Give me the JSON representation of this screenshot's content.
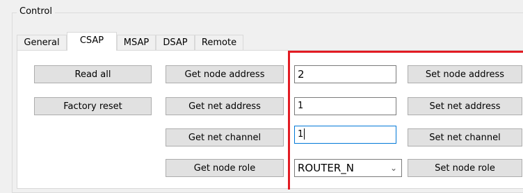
{
  "group": {
    "title": "Control"
  },
  "tabs": [
    {
      "label": "General",
      "active": false
    },
    {
      "label": "CSAP",
      "active": true
    },
    {
      "label": "MSAP",
      "active": false
    },
    {
      "label": "DSAP",
      "active": false
    },
    {
      "label": "Remote",
      "active": false
    }
  ],
  "buttons": {
    "read_all": "Read all",
    "factory_reset": "Factory reset",
    "get_node_address": "Get node address",
    "get_net_address": "Get net address",
    "get_net_channel": "Get net channel",
    "get_node_role": "Get node role",
    "set_node_address": "Set node address",
    "set_net_address": "Set net address",
    "set_net_channel": "Set net channel",
    "set_node_role": "Set node role"
  },
  "fields": {
    "node_address": "2",
    "net_address": "1",
    "net_channel": "1"
  },
  "node_role": {
    "selected": "ROUTER_N",
    "arrow_icon": "chevron-down-icon"
  },
  "colors": {
    "highlight": "#e21b23",
    "focus_border": "#0078d7",
    "button_bg": "#e1e1e1"
  }
}
